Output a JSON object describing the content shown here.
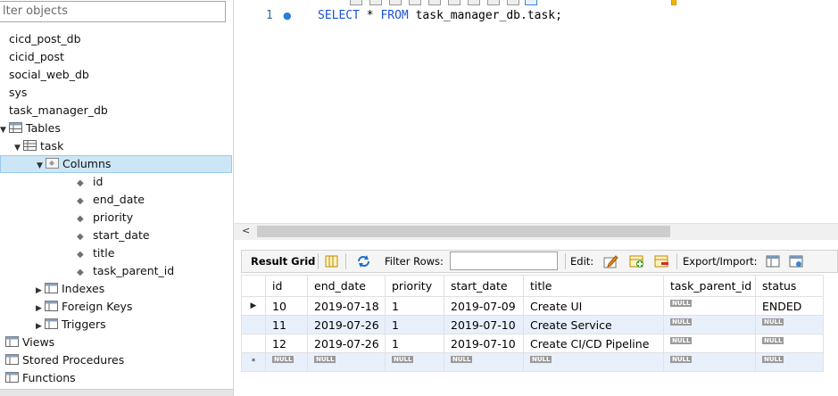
{
  "navigator": {
    "filter_placeholder": "lter objects",
    "schemas": [
      "cicd_post_db",
      "cicid_post",
      "social_web_db",
      "sys",
      "task_manager_db"
    ],
    "tables_label": "Tables",
    "table_name": "task",
    "columns_label": "Columns",
    "columns": [
      "id",
      "end_date",
      "priority",
      "start_date",
      "title",
      "task_parent_id"
    ],
    "indexes_label": "Indexes",
    "foreign_keys_label": "Foreign Keys",
    "triggers_label": "Triggers",
    "views_label": "Views",
    "stored_procedures_label": "Stored Procedures",
    "functions_label": "Functions"
  },
  "editor": {
    "line_number": "1",
    "select_kw": "SELECT",
    "star": " * ",
    "from_kw": "FROM",
    "target": " task_manager_db.task;"
  },
  "result_toolbar": {
    "result_grid": "Result Grid",
    "filter_rows": "Filter Rows:",
    "edit": "Edit:",
    "export_import": "Export/Import:"
  },
  "grid": {
    "headers": [
      "id",
      "end_date",
      "priority",
      "start_date",
      "title",
      "task_parent_id",
      "status"
    ],
    "null_text": "NULL",
    "current_row_marker": "▶",
    "new_row_marker": "*",
    "rows": [
      [
        "10",
        "2019-07-18",
        "1",
        "2019-07-09",
        "Create UI",
        "NULL",
        "ENDED"
      ],
      [
        "11",
        "2019-07-26",
        "1",
        "2019-07-10",
        "Create Service",
        "NULL",
        "NULL"
      ],
      [
        "12",
        "2019-07-26",
        "1",
        "2019-07-10",
        "Create CI/CD Pipeline",
        "NULL",
        "NULL"
      ]
    ]
  },
  "colors": {
    "keyword": "#1a53d6",
    "selection": "#cde6f7",
    "alt_row": "#e8f0fb"
  }
}
